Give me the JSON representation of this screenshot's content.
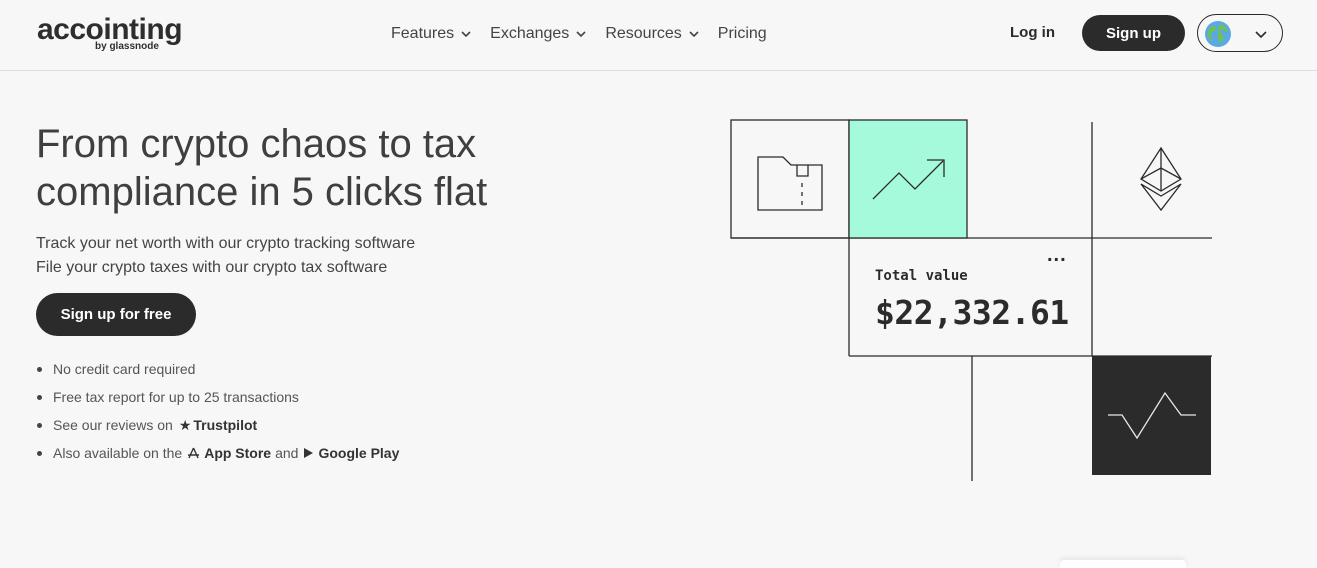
{
  "header": {
    "logo_main": "accointing",
    "logo_sub": "by glassnode",
    "nav": [
      {
        "label": "Features",
        "has_dropdown": true
      },
      {
        "label": "Exchanges",
        "has_dropdown": true
      },
      {
        "label": "Resources",
        "has_dropdown": true
      },
      {
        "label": "Pricing",
        "has_dropdown": false
      }
    ],
    "login_label": "Log in",
    "signup_label": "Sign up",
    "language_icon": "globe-icon"
  },
  "hero": {
    "headline": "From crypto chaos to tax compliance in 5 clicks flat",
    "sub_line_1": "Track your net worth with our crypto tracking software",
    "sub_line_2": "File your crypto taxes with our crypto tax software",
    "cta_label": "Sign up for free",
    "bullets": {
      "b1": "No credit card required",
      "b2": "Free tax report for up to 25 transactions",
      "b3_prefix": "See our reviews on",
      "b3_link": "Trustpilot",
      "b4_prefix": "Also available on the",
      "b4_link1": "App Store",
      "b4_mid": "and",
      "b4_link2": "Google Play"
    }
  },
  "illustration": {
    "total_label": "Total value",
    "total_value": "$22,332.61",
    "menu_dots": "...",
    "accent_color": "#a6fadc",
    "dark_color": "#2b2b2b"
  }
}
